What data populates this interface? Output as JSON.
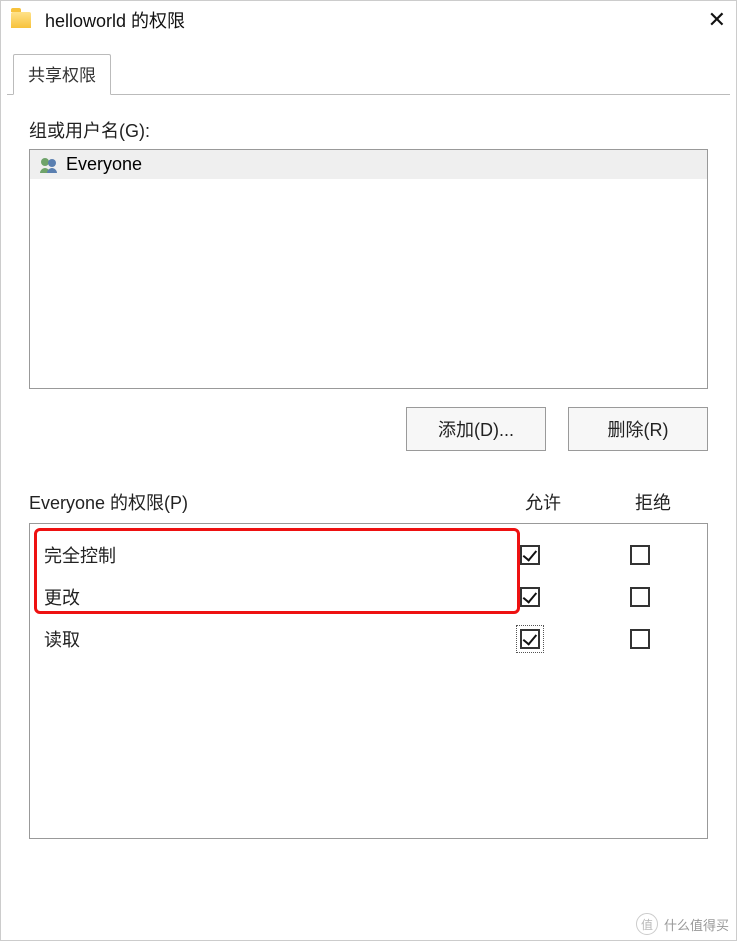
{
  "window": {
    "title": "helloworld 的权限"
  },
  "tabs": [
    {
      "label": "共享权限"
    }
  ],
  "groupsLabel": "组或用户名(G):",
  "users": [
    {
      "name": "Everyone"
    }
  ],
  "buttons": {
    "add": "添加(D)...",
    "remove": "删除(R)"
  },
  "permHeader": {
    "title": "Everyone 的权限(P)",
    "allow": "允许",
    "deny": "拒绝"
  },
  "permissions": [
    {
      "name": "完全控制",
      "allow": true,
      "deny": false,
      "highlighted": true
    },
    {
      "name": "更改",
      "allow": true,
      "deny": false,
      "highlighted": true
    },
    {
      "name": "读取",
      "allow": true,
      "deny": false,
      "focused": true
    }
  ],
  "watermark": {
    "badge": "值",
    "text": "什么值得买"
  }
}
